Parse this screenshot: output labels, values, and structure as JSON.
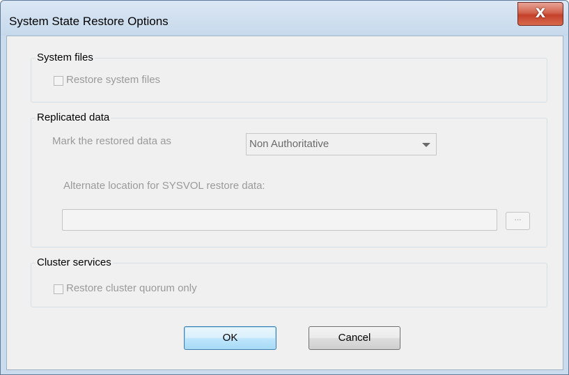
{
  "window": {
    "title": "System State Restore Options",
    "close_label": "X"
  },
  "system_files": {
    "legend": "System files",
    "restore_label": "Restore system files",
    "restore_checked": false
  },
  "replicated_data": {
    "legend": "Replicated data",
    "mark_label": "Mark the restored data as",
    "mark_value": "Non Authoritative",
    "alt_location_label": "Alternate location for SYSVOL restore data:",
    "alt_location_value": "",
    "browse_label": "..."
  },
  "cluster_services": {
    "legend": "Cluster services",
    "quorum_label": "Restore cluster quorum only",
    "quorum_checked": false
  },
  "buttons": {
    "ok": "OK",
    "cancel": "Cancel"
  }
}
